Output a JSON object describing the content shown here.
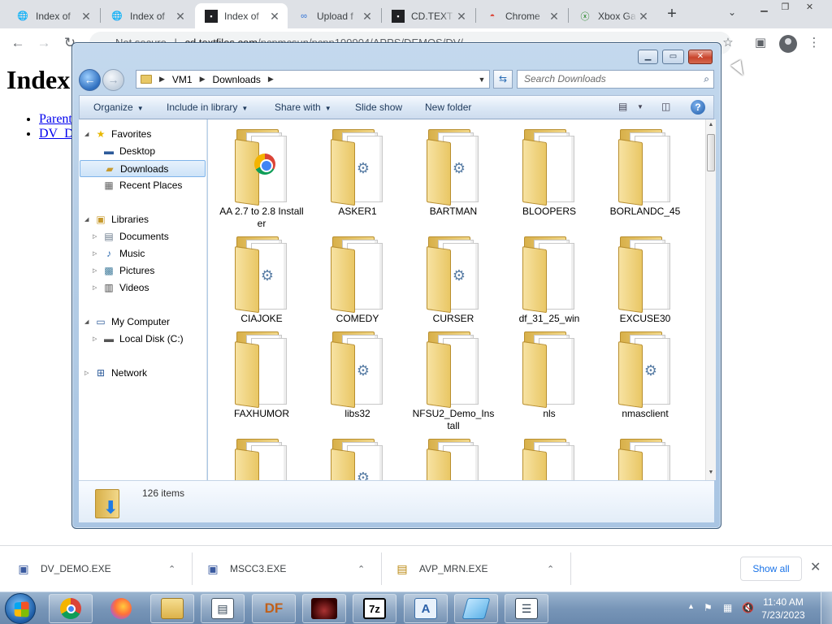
{
  "browser": {
    "tabs": [
      {
        "title": "Index of",
        "favicon": "globe-icon"
      },
      {
        "title": "Index of",
        "favicon": "globe-icon"
      },
      {
        "title": "Index of",
        "favicon": "doc-icon"
      },
      {
        "title": "Upload f",
        "favicon": "upload-icon"
      },
      {
        "title": "CD.TEXT",
        "favicon": "doc-icon"
      },
      {
        "title": "Chrome",
        "favicon": "chrome-icon"
      },
      {
        "title": "Xbox Ga",
        "favicon": "xbox-icon"
      }
    ],
    "omnibox": {
      "security": "Not secure",
      "url_host": "cd.textfiles.com",
      "url_path": "/pcpmcsun/pcpp199904/APPS/DEMOS/DV/"
    }
  },
  "page": {
    "heading": "Index",
    "links": [
      "Parent",
      "DV_D"
    ]
  },
  "explorer": {
    "breadcrumb": [
      "VM1",
      "Downloads"
    ],
    "search_placeholder": "Search Downloads",
    "commands": [
      "Organize",
      "Include in library",
      "Share with",
      "Slide show",
      "New folder"
    ],
    "nav": {
      "favorites": "Favorites",
      "desktop": "Desktop",
      "downloads": "Downloads",
      "recent": "Recent Places",
      "libraries": "Libraries",
      "documents": "Documents",
      "music": "Music",
      "pictures": "Pictures",
      "videos": "Videos",
      "computer": "My Computer",
      "localdisk": "Local Disk (C:)",
      "network": "Network"
    },
    "folders": [
      {
        "name": "AA 2.7 to 2.8 Installer",
        "emblem": "chrome-icon"
      },
      {
        "name": "ASKER1",
        "emblem": "gear-icon"
      },
      {
        "name": "BARTMAN",
        "emblem": "gear-icon"
      },
      {
        "name": "BLOOPERS",
        "emblem": "document-icon"
      },
      {
        "name": "BORLANDC_45",
        "emblem": "document-icon"
      },
      {
        "name": "CIAJOKE",
        "emblem": "gear-icon"
      },
      {
        "name": "COMEDY",
        "emblem": "document-icon"
      },
      {
        "name": "CURSER",
        "emblem": "gear-icon"
      },
      {
        "name": "df_31_25_win",
        "emblem": "document-icon"
      },
      {
        "name": "EXCUSE30",
        "emblem": "document-icon"
      },
      {
        "name": "FAXHUMOR",
        "emblem": "document-icon"
      },
      {
        "name": "libs32",
        "emblem": "gear-icon"
      },
      {
        "name": "NFSU2_Demo_Install",
        "emblem": "document-icon"
      },
      {
        "name": "nls",
        "emblem": "document-icon"
      },
      {
        "name": "nmasclient",
        "emblem": "gear-icon"
      },
      {
        "name": "",
        "emblem": "document-icon"
      },
      {
        "name": "",
        "emblem": "gear-icon"
      },
      {
        "name": "",
        "emblem": "document-icon"
      },
      {
        "name": "",
        "emblem": "document-icon"
      },
      {
        "name": "",
        "emblem": "document-icon"
      }
    ],
    "item_count": "126 items"
  },
  "downloads": [
    {
      "name": "DV_DEMO.EXE"
    },
    {
      "name": "MSCC3.EXE"
    },
    {
      "name": "AVP_MRN.EXE"
    }
  ],
  "downloads_show_all": "Show all",
  "taskbar": {
    "apps": [
      {
        "name": "chrome",
        "glyph": ""
      },
      {
        "name": "firefox",
        "glyph": ""
      },
      {
        "name": "explorer",
        "glyph": ""
      },
      {
        "name": "notepad",
        "glyph": ""
      },
      {
        "name": "df",
        "glyph": "DF"
      },
      {
        "name": "app-dark",
        "glyph": ""
      },
      {
        "name": "7zip",
        "glyph": "7z"
      },
      {
        "name": "wordpad",
        "glyph": "A"
      },
      {
        "name": "eraser",
        "glyph": ""
      },
      {
        "name": "list",
        "glyph": ""
      }
    ],
    "time": "11:40 AM",
    "date": "7/23/2023"
  },
  "colors": {
    "accent": "#1a73e8",
    "folder": "#e9c765",
    "selection": "#cde3f8"
  }
}
